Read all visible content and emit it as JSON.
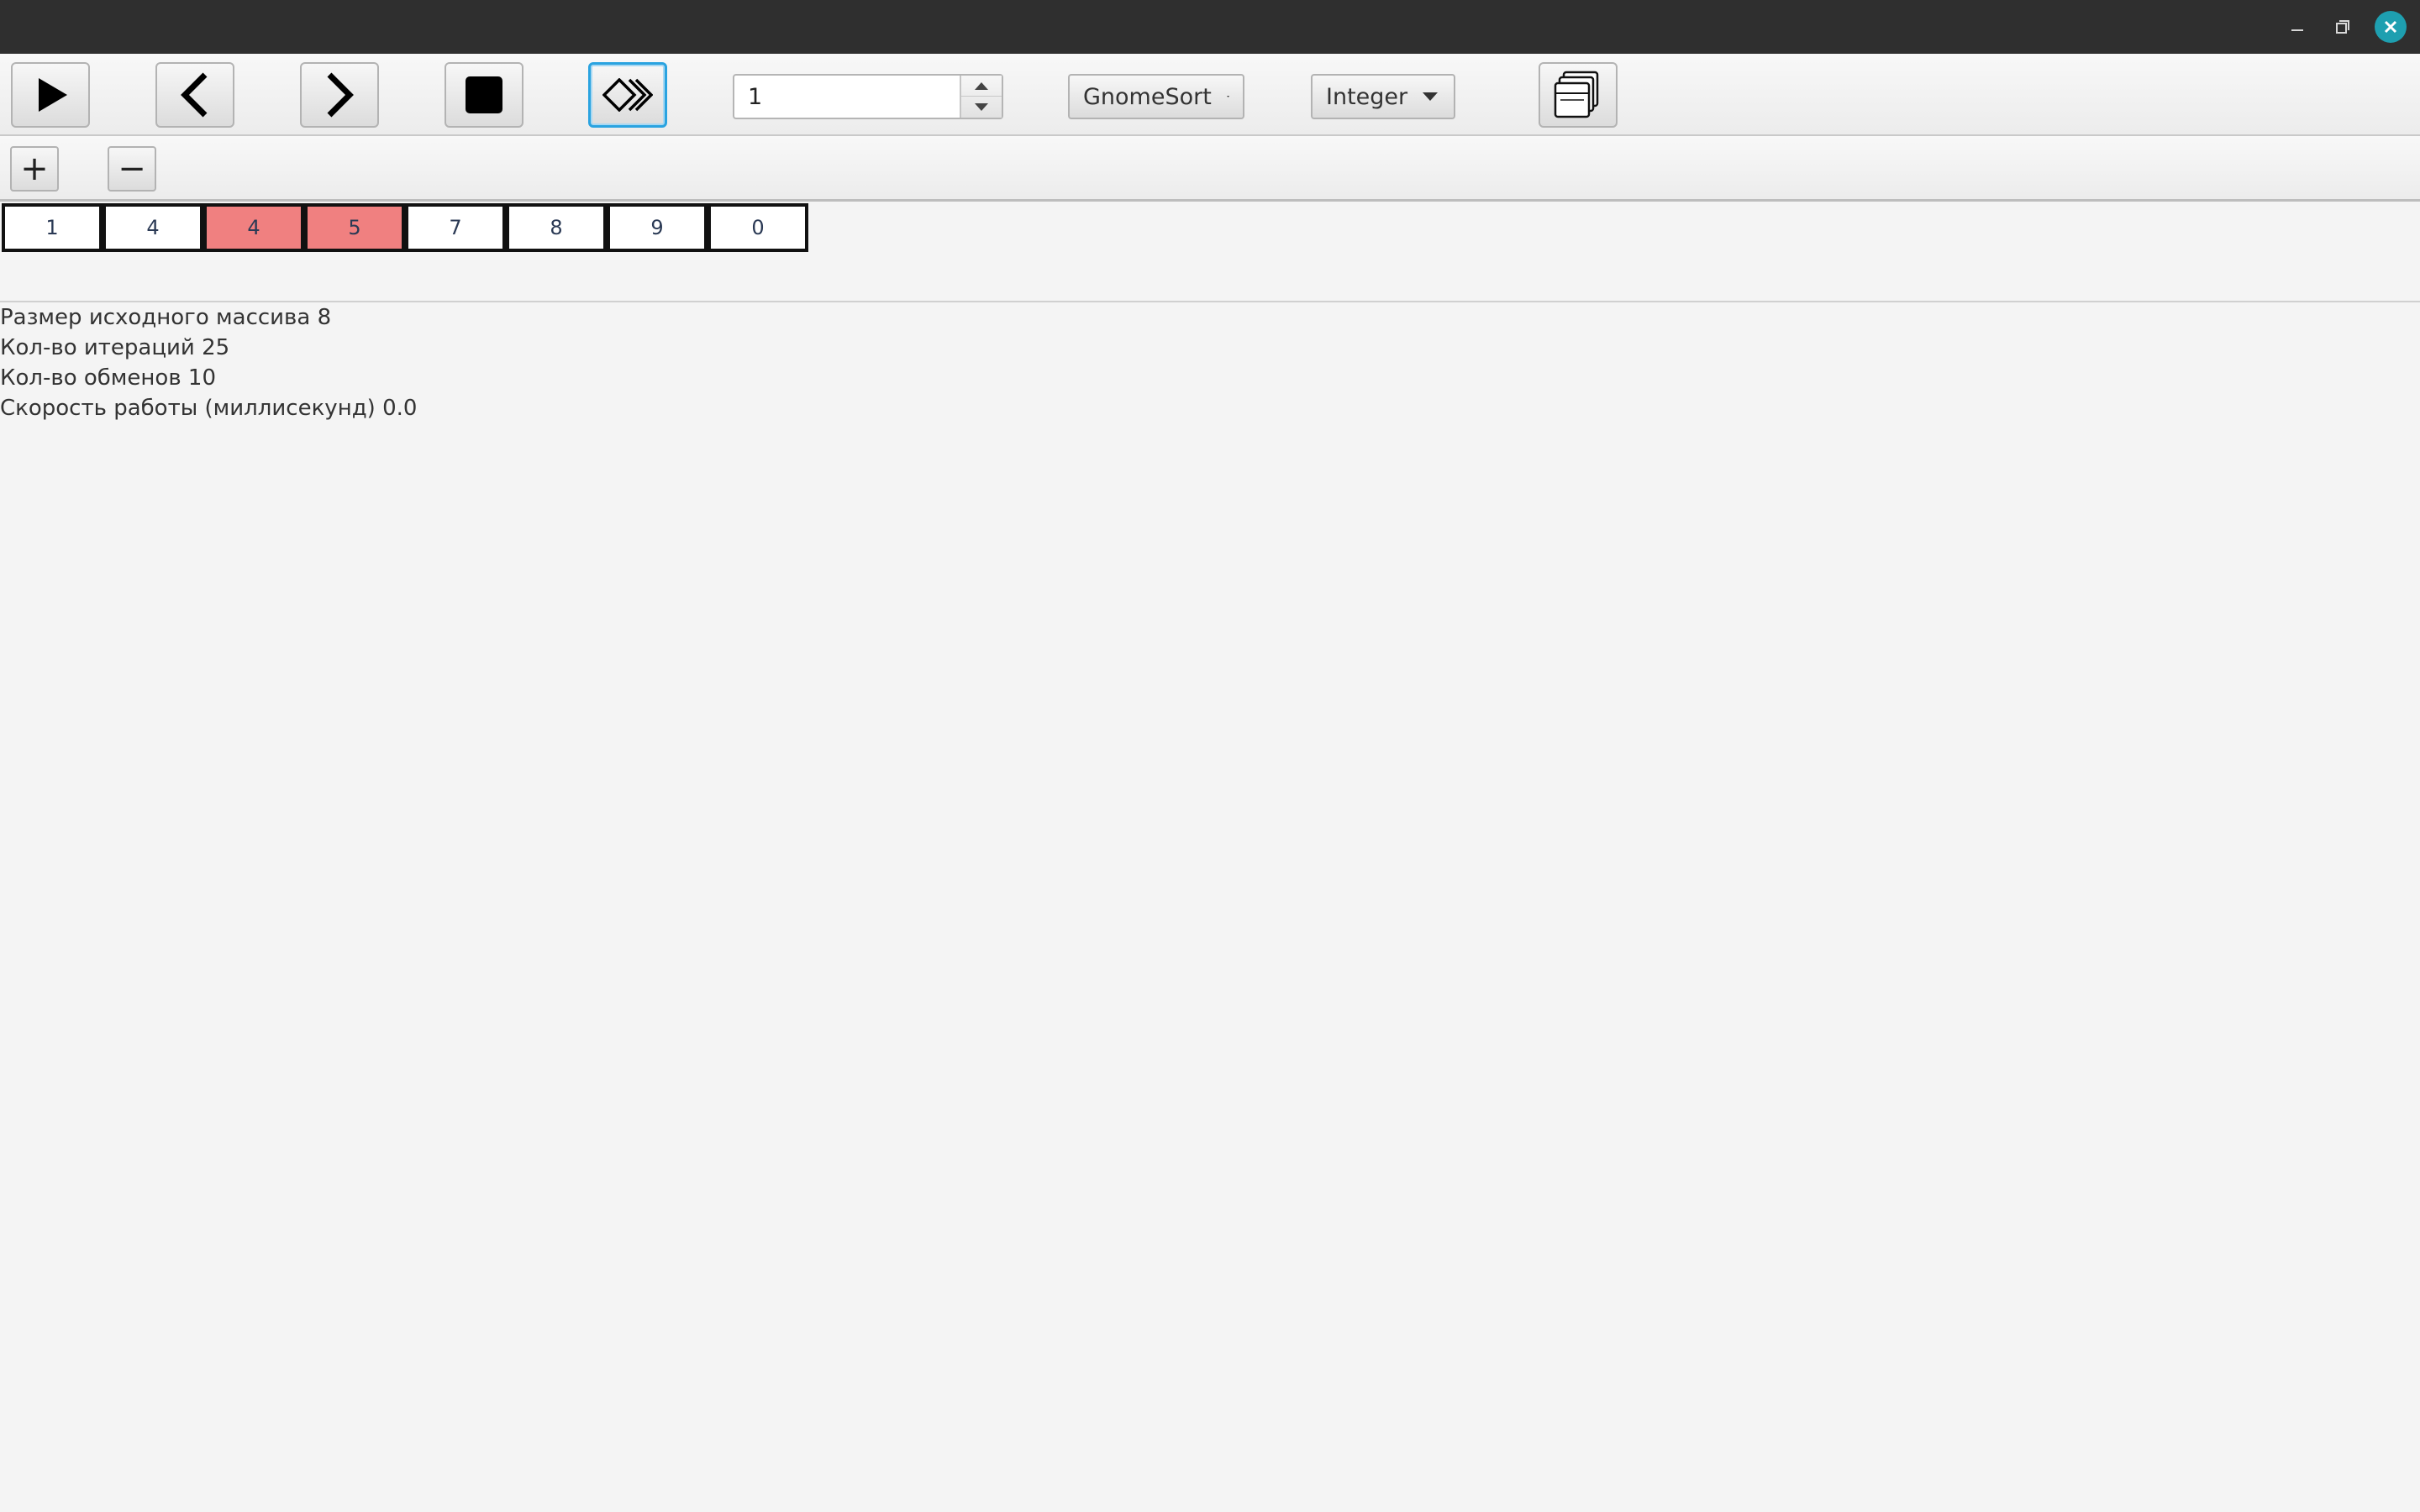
{
  "window": {
    "controls": [
      "minimize-icon",
      "maximize-icon",
      "close-icon"
    ],
    "close_color": "#1e9fb0"
  },
  "toolbar": {
    "buttons": [
      "play-icon",
      "previous-icon",
      "next-icon",
      "stop-icon",
      "fast-forward-icon",
      "export-icon"
    ],
    "delay_value": "1",
    "algorithm_selected": "GnomeSort",
    "type_selected": "Integer"
  },
  "size_controls": {
    "add_label": "+",
    "remove_label": "−"
  },
  "array": {
    "cells": [
      "1",
      "4",
      "4",
      "5",
      "7",
      "8",
      "9",
      "0"
    ],
    "highlight_color": "#f08080"
  },
  "stats": {
    "size": "Размер исходного массива 8",
    "iterations": "Кол-во итераций 25",
    "swaps": "Кол-во обменов 10",
    "speed": "Скорость работы (миллисекунд) 0.0"
  }
}
